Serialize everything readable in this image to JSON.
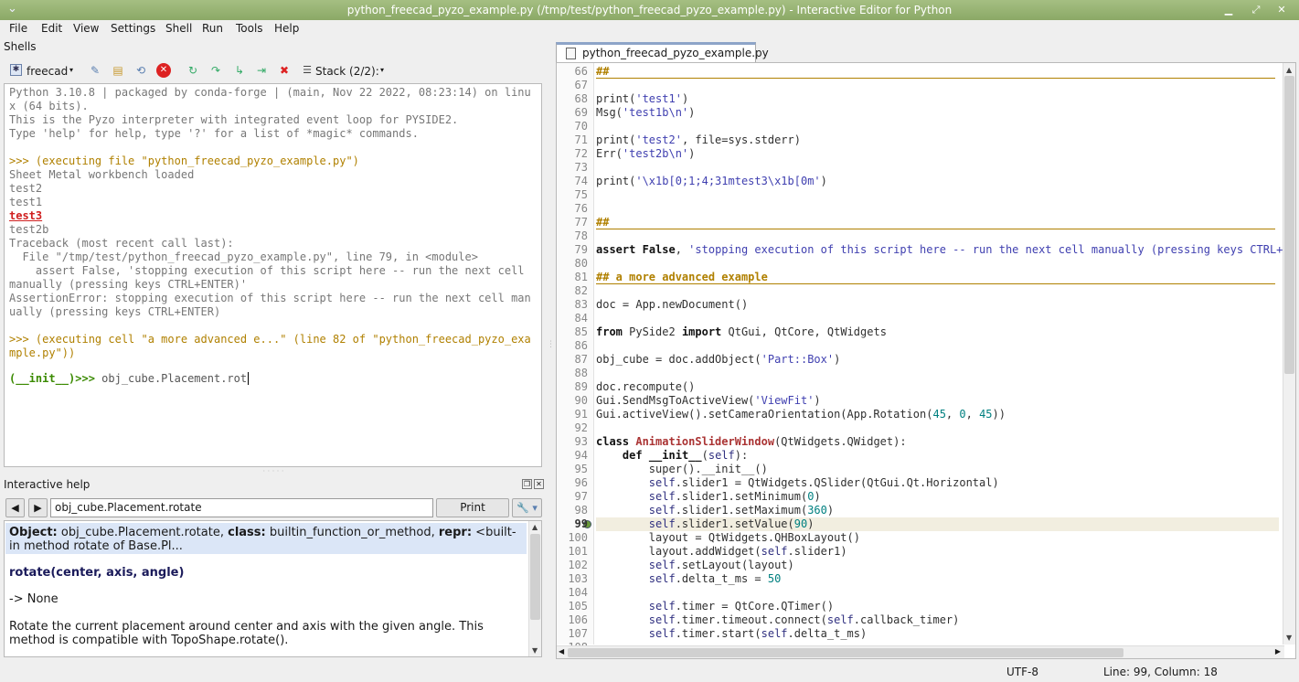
{
  "window": {
    "title": "python_freecad_pyzo_example.py (/tmp/test/python_freecad_pyzo_example.py) - Interactive Editor for Python"
  },
  "menu": [
    "File",
    "Edit",
    "View",
    "Settings",
    "Shell",
    "Run",
    "Tools",
    "Help"
  ],
  "shells_panel": {
    "title": "Shells",
    "shell_name": "freecad",
    "stack_label": "Stack (2/2):",
    "output": [
      {
        "text": "Python 3.10.8 | packaged by conda-forge | (main, Nov 22 2022, 08:23:14) on linu",
        "style": ""
      },
      {
        "text": "x (64 bits).",
        "style": ""
      },
      {
        "text": "This is the Pyzo interpreter with integrated event loop for PYSIDE2.",
        "style": ""
      },
      {
        "text": "Type 'help' for help, type '?' for a list of *magic* commands.",
        "style": ""
      },
      {
        "text": "",
        "style": ""
      },
      {
        "text": ">>> (executing file \"python_freecad_pyzo_example.py\")",
        "style": "gold"
      },
      {
        "text": "Sheet Metal workbench loaded",
        "style": ""
      },
      {
        "text": "test2",
        "style": ""
      },
      {
        "text": "test1",
        "style": ""
      },
      {
        "text": "test3",
        "style": "red"
      },
      {
        "text": "test2b",
        "style": ""
      },
      {
        "text": "Traceback (most recent call last):",
        "style": ""
      },
      {
        "text": "  File \"/tmp/test/python_freecad_pyzo_example.py\", line 79, in <module>",
        "style": ""
      },
      {
        "text": "    assert False, 'stopping execution of this script here -- run the next cell",
        "style": ""
      },
      {
        "text": "manually (pressing keys CTRL+ENTER)'",
        "style": ""
      },
      {
        "text": "AssertionError: stopping execution of this script here -- run the next cell man",
        "style": ""
      },
      {
        "text": "ually (pressing keys CTRL+ENTER)",
        "style": ""
      },
      {
        "text": "",
        "style": ""
      },
      {
        "text": ">>> (executing cell \"a more advanced e...\" (line 82 of \"python_freecad_pyzo_exa",
        "style": "gold"
      },
      {
        "text": "mple.py\"))",
        "style": "gold"
      },
      {
        "text": "",
        "style": ""
      }
    ],
    "prompt_prefix": "(__init__)>>>",
    "prompt_input": " obj_cube.Placement.rot"
  },
  "help_panel": {
    "title": "Interactive help",
    "query": "obj_cube.Placement.rotate",
    "print_label": "Print",
    "object_label": "Object:",
    "object_value": " obj_cube.Placement.rotate, ",
    "class_label": "class:",
    "class_value": " builtin_function_or_method, ",
    "repr_label": "repr:",
    "repr_value": " <built-",
    "repr_cont": "in method rotate of Base.Pl...",
    "signature": "rotate(center, axis, angle)",
    "returns": "-> None",
    "desc_line1": "Rotate the current placement around center and axis with the given angle. This",
    "desc_line2": "method is compatible with TopoShape.rotate()."
  },
  "editor": {
    "tab_label": "python_freecad_pyzo_example.py",
    "current_line": 99,
    "first_line": 66,
    "lines": [
      "##",
      "",
      "print('test1')",
      "Msg('test1b\\n')",
      "",
      "print('test2', file=sys.stderr)",
      "Err('test2b\\n')",
      "",
      "print('\\x1b[0;1;4;31mtest3\\x1b[0m')",
      "",
      "",
      "##",
      "",
      "assert False, 'stopping execution of this script here -- run the next cell manually (pressing keys CTRL+",
      "",
      "## a more advanced example",
      "",
      "doc = App.newDocument()",
      "",
      "from PySide2 import QtGui, QtCore, QtWidgets",
      "",
      "obj_cube = doc.addObject('Part::Box')",
      "",
      "doc.recompute()",
      "Gui.SendMsgToActiveView('ViewFit')",
      "Gui.activeView().setCameraOrientation(App.Rotation(45, 0, 45))",
      "",
      "class AnimationSliderWindow(QtWidgets.QWidget):",
      "    def __init__(self):",
      "        super().__init__()",
      "        self.slider1 = QtWidgets.QSlider(QtGui.Qt.Horizontal)",
      "        self.slider1.setMinimum(0)",
      "        self.slider1.setMaximum(360)",
      "        self.slider1.setValue(90)",
      "        layout = QtWidgets.QHBoxLayout()",
      "        layout.addWidget(self.slider1)",
      "        self.setLayout(layout)",
      "        self.delta_t_ms = 50",
      "",
      "        self.timer = QtCore.QTimer()",
      "        self.timer.timeout.connect(self.callback_timer)",
      "        self.timer.start(self.delta_t_ms)"
    ],
    "partial_line": "108"
  },
  "status": {
    "encoding": "UTF-8",
    "position": "Line: 99, Column: 18"
  }
}
